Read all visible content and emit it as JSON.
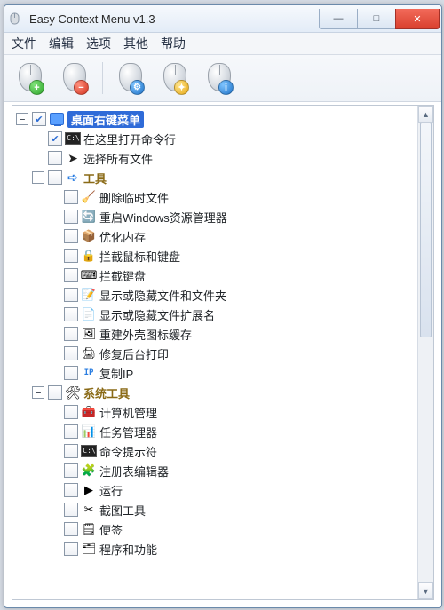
{
  "window": {
    "title": "Easy Context Menu v1.3"
  },
  "menu": {
    "file": "文件",
    "edit": "编辑",
    "options": "选项",
    "other": "其他",
    "help": "帮助"
  },
  "toolbar": {
    "add": "+",
    "remove": "−",
    "settings": "⚙",
    "clean": "✦",
    "info": "i"
  },
  "winbtns": {
    "min": "—",
    "max": "□",
    "close": "✕"
  },
  "tree": {
    "root": {
      "exp": "−",
      "checked": true,
      "label": "桌面右键菜单",
      "children": [
        {
          "checked": true,
          "icon": "cmd",
          "label": "在这里打开命令行"
        },
        {
          "checked": false,
          "icon": "cursor",
          "label": "选择所有文件"
        }
      ]
    },
    "tools": {
      "exp": "−",
      "checked": false,
      "label": "工具",
      "children": [
        {
          "icon": "🧹",
          "label": "删除临时文件"
        },
        {
          "icon": "🔄",
          "label": "重启Windows资源管理器"
        },
        {
          "icon": "📦",
          "label": "优化内存"
        },
        {
          "icon": "🔒",
          "label": "拦截鼠标和键盘"
        },
        {
          "icon": "⌨",
          "label": "拦截键盘"
        },
        {
          "icon": "📝",
          "label": "显示或隐藏文件和文件夹"
        },
        {
          "icon": "📄",
          "label": "显示或隐藏文件扩展名"
        },
        {
          "icon": "🖼",
          "label": "重建外壳图标缓存"
        },
        {
          "icon": "🖨",
          "label": "修复后台打印"
        },
        {
          "icon": "ip",
          "label": "复制IP"
        }
      ]
    },
    "systools": {
      "exp": "−",
      "checked": false,
      "label": "系统工具",
      "children": [
        {
          "icon": "🧰",
          "label": "计算机管理"
        },
        {
          "icon": "📊",
          "label": "任务管理器"
        },
        {
          "icon": "cmd",
          "label": "命令提示符"
        },
        {
          "icon": "🧩",
          "label": "注册表编辑器"
        },
        {
          "icon": "▶",
          "label": "运行"
        },
        {
          "icon": "✂",
          "label": "截图工具"
        },
        {
          "icon": "🗒",
          "label": "便签"
        },
        {
          "icon": "🗂",
          "label": "程序和功能"
        }
      ]
    }
  }
}
